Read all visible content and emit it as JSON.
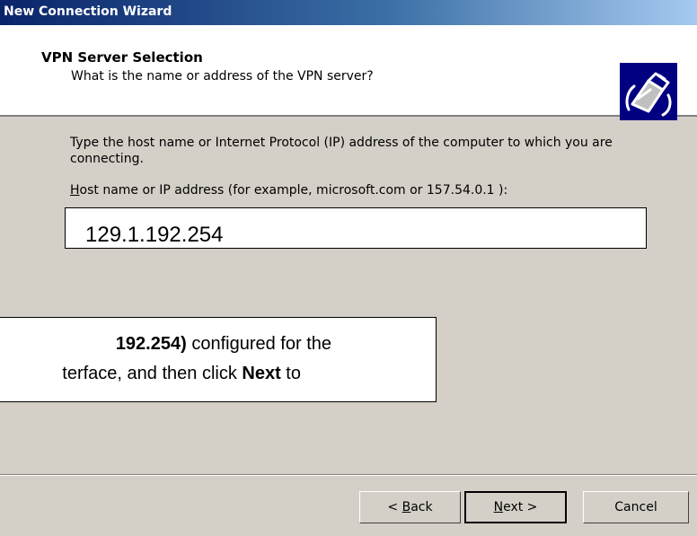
{
  "window": {
    "title": "New Connection Wizard"
  },
  "header": {
    "title": "VPN Server Selection",
    "subtitle": "What is the name or address of the VPN server?",
    "icon": "vpn-connection-icon"
  },
  "content": {
    "description": "Type the host name or Internet Protocol (IP) address of the computer to which you are connecting.",
    "host_label_prefix": "H",
    "host_label_rest": "ost name or IP address (for example, microsoft.com or 157.54.0.1 ):",
    "host_value": "129.1.192.254"
  },
  "callout": {
    "line1_bold": "192.254)",
    "line1_rest": " configured for the",
    "line2_before": "terface, and then click ",
    "line2_bold": "Next",
    "line2_after": " to"
  },
  "buttons": {
    "back_prefix": "< ",
    "back_key": "B",
    "back_rest": "ack",
    "next_key": "N",
    "next_rest": "ext >",
    "cancel": "Cancel"
  }
}
